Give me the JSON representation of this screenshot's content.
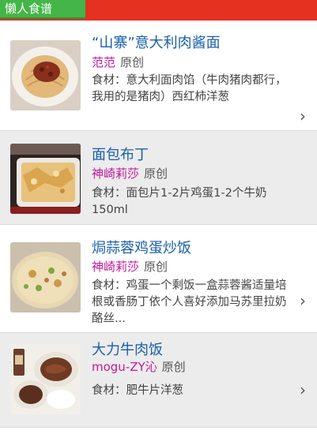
{
  "header": {
    "title": "懒人食谱"
  },
  "recipes": [
    {
      "title": "“山寨”意大利肉酱面",
      "author": "范范",
      "tag": "原创",
      "desc": "食材：意大利面肉馅（牛肉猪肉都行，我用的是猪肉）西红柿洋葱",
      "thumb_icon": "spaghetti-thumbnail"
    },
    {
      "title": "面包布丁",
      "author": "神崎莉莎",
      "tag": "原创",
      "desc": "食材：面包片1-2片鸡蛋1-2个牛奶150ml",
      "thumb_icon": "bread-pudding-thumbnail"
    },
    {
      "title": "焗蒜蓉鸡蛋炒饭",
      "author": "神崎莉莎",
      "tag": "原创",
      "desc": "食材：鸡蛋一个剩饭一盒蒜蓉酱适量培根或香肠丁依个人喜好添加马苏里拉奶酪丝...",
      "thumb_icon": "baked-rice-thumbnail"
    },
    {
      "title": "大力牛肉饭",
      "author": "mogu-ZY沁",
      "tag": "原创",
      "desc": "食材：肥牛片洋葱",
      "thumb_icon": "beef-rice-thumbnail"
    }
  ],
  "chevron": "›"
}
